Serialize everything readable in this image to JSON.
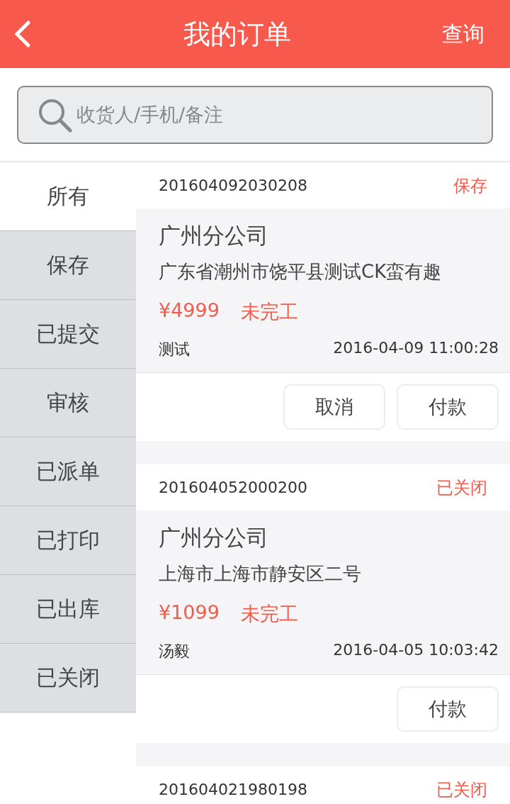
{
  "header": {
    "title": "我的订单",
    "action": "查询"
  },
  "search": {
    "placeholder": "收货人/手机/备注"
  },
  "sidebar": {
    "items": [
      {
        "label": "所有",
        "selected": true
      },
      {
        "label": "保存",
        "selected": false
      },
      {
        "label": "已提交",
        "selected": false
      },
      {
        "label": "审核",
        "selected": false
      },
      {
        "label": "已派单",
        "selected": false
      },
      {
        "label": "已打印",
        "selected": false
      },
      {
        "label": "已出库",
        "selected": false
      },
      {
        "label": "已关闭",
        "selected": false
      }
    ]
  },
  "orders": [
    {
      "number": "201604092030208",
      "status": "保存",
      "company": "广州分公司",
      "address": "广东省潮州市饶平县测试CK蛮有趣",
      "price": "¥4999",
      "progress": "未完工",
      "customer": "测试",
      "time": "2016-04-09 11:00:28",
      "buttons": [
        "取消",
        "付款"
      ]
    },
    {
      "number": "201604052000200",
      "status": "已关闭",
      "company": "广州分公司",
      "address": "上海市上海市静安区二号",
      "price": "¥1099",
      "progress": "未完工",
      "customer": "汤毅",
      "time": "2016-04-05 10:03:42",
      "buttons": [
        "付款"
      ]
    },
    {
      "number": "201604021980198",
      "status": "已关闭"
    }
  ]
}
